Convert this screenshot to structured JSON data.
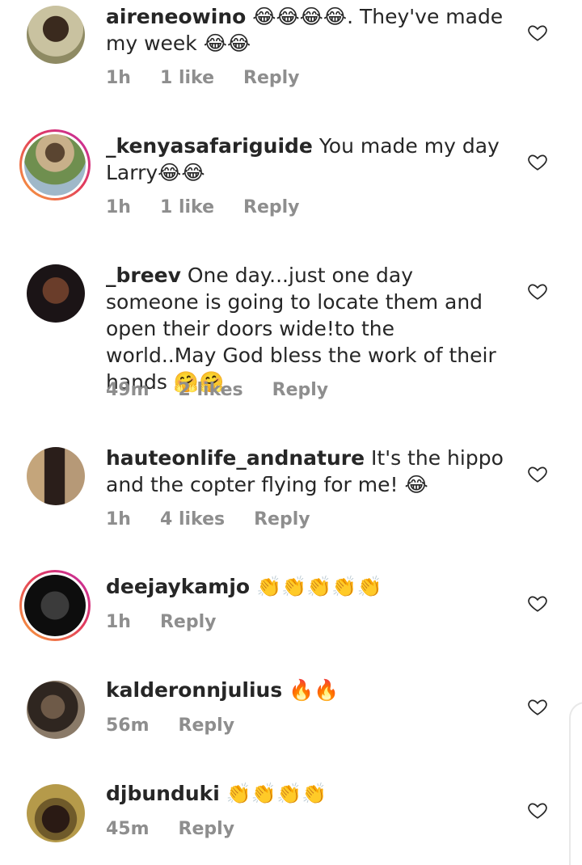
{
  "comments": [
    {
      "username": "aireneowino",
      "text": " 😂😂😂😂. They've made my week 😂😂",
      "time": "1h",
      "likes": "1 like",
      "reply": "Reply"
    },
    {
      "username": "_kenyasafariguide",
      "text": " You made my day Larry😂😂",
      "time": "1h",
      "likes": "1 like",
      "reply": "Reply"
    },
    {
      "username": "_breev",
      "text": " One day...just one day someone is going to locate them and open their doors wide!to the world..May God bless the work of their hands 🤗🤗",
      "time": "49m",
      "likes": "2 likes",
      "reply": "Reply"
    },
    {
      "username": "hauteonlife_andnature",
      "text": " It's the hippo and the copter flying for me! 😂",
      "time": "1h",
      "likes": "4 likes",
      "reply": "Reply"
    },
    {
      "username": "deejaykamjo",
      "text": " 👏👏👏👏👏",
      "time": "1h",
      "likes": "",
      "reply": "Reply"
    },
    {
      "username": "kalderonnjulius",
      "text": " 🔥🔥",
      "time": "56m",
      "likes": "",
      "reply": "Reply"
    },
    {
      "username": "djbunduki",
      "text": " 👏👏👏👏",
      "time": "45m",
      "likes": "",
      "reply": "Reply"
    }
  ]
}
